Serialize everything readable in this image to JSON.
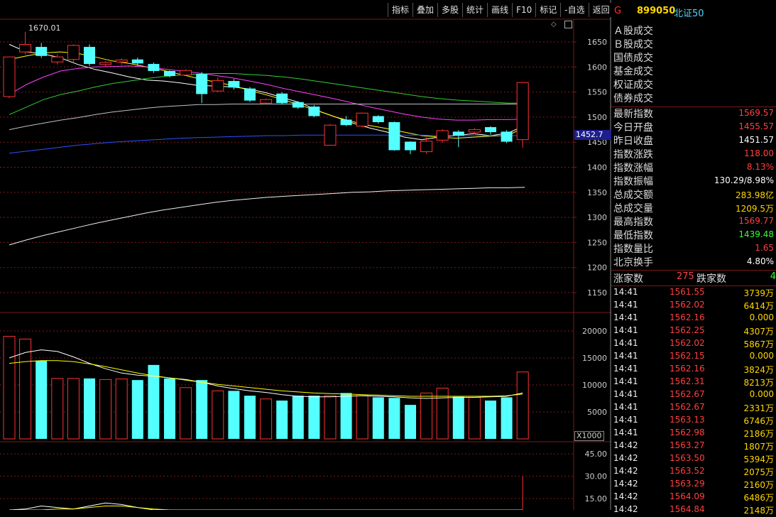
{
  "toolbar": [
    "指标",
    "叠加",
    "多股",
    "统计",
    "画线",
    "F10",
    "标记",
    "-自选",
    "返回"
  ],
  "stock": {
    "flag": "G",
    "code": "899050",
    "name": "北证50"
  },
  "price_tag": "1452.7",
  "peak_label": "1670.01",
  "volume_unit": "X1000",
  "price_axis": [
    "1650",
    "1600",
    "1550",
    "1500",
    "1450",
    "1400",
    "1350",
    "1300",
    "1250",
    "1200",
    "1150"
  ],
  "volume_axis": [
    "20000",
    "15000",
    "10000",
    "5000"
  ],
  "indicator_axis": [
    "45.00",
    "30.00",
    "15.00"
  ],
  "category_labels": [
    "Ａ股成交",
    "Ｂ股成交",
    "国债成交",
    "基金成交",
    "权证成交",
    "债券成交"
  ],
  "stats": [
    {
      "label": "最新指数",
      "value": "1569.57",
      "color": "#ff4040"
    },
    {
      "label": "今日开盘",
      "value": "1455.57",
      "color": "#ff4040"
    },
    {
      "label": "昨日收盘",
      "value": "1451.57",
      "color": "#ffffff"
    },
    {
      "label": "指数涨跌",
      "value": "118.00",
      "color": "#ff4040"
    },
    {
      "label": "指数涨幅",
      "value": "8.13%",
      "color": "#ff4040"
    },
    {
      "label": "指数振幅",
      "value": "130.29/8.98%",
      "color": "#ffffff"
    },
    {
      "label": "总成交额",
      "value": "283.98亿",
      "color": "#ffd700"
    },
    {
      "label": "总成交量",
      "value": "1209.5万",
      "color": "#ffd700"
    },
    {
      "label": "最高指数",
      "value": "1569.77",
      "color": "#ff4040"
    },
    {
      "label": "最低指数",
      "value": "1439.48",
      "color": "#32ff32"
    },
    {
      "label": "指数量比",
      "value": "1.65",
      "color": "#ff4040"
    },
    {
      "label": "北京换手",
      "value": "4.80%",
      "color": "#ffffff"
    }
  ],
  "updown": {
    "up_label": "涨家数",
    "up": "275",
    "down_label": "跌家数",
    "down": "4"
  },
  "ticks": [
    {
      "t": "14:41",
      "p": "1561.55",
      "v": "3739万"
    },
    {
      "t": "14:41",
      "p": "1562.02",
      "v": "6414万"
    },
    {
      "t": "14:41",
      "p": "1562.16",
      "v": "0.000"
    },
    {
      "t": "14:41",
      "p": "1562.25",
      "v": "4307万"
    },
    {
      "t": "14:41",
      "p": "1562.02",
      "v": "5867万"
    },
    {
      "t": "14:41",
      "p": "1562.15",
      "v": "0.000"
    },
    {
      "t": "14:41",
      "p": "1562.16",
      "v": "3824万"
    },
    {
      "t": "14:41",
      "p": "1562.31",
      "v": "8213万"
    },
    {
      "t": "14:41",
      "p": "1562.67",
      "v": "0.000"
    },
    {
      "t": "14:41",
      "p": "1562.67",
      "v": "2331万"
    },
    {
      "t": "14:41",
      "p": "1563.13",
      "v": "6746万"
    },
    {
      "t": "14:41",
      "p": "1562.98",
      "v": "2186万"
    },
    {
      "t": "14:42",
      "p": "1563.27",
      "v": "1807万"
    },
    {
      "t": "14:42",
      "p": "1563.50",
      "v": "5394万"
    },
    {
      "t": "14:42",
      "p": "1563.52",
      "v": "2075万"
    },
    {
      "t": "14:42",
      "p": "1563.29",
      "v": "2160万"
    },
    {
      "t": "14:42",
      "p": "1564.09",
      "v": "6486万"
    },
    {
      "t": "14:42",
      "p": "1564.84",
      "v": "2148万"
    }
  ],
  "colors": {
    "up": "#ff3232",
    "down": "#54ffff",
    "grid": "#7a1a1a"
  },
  "chart_data": {
    "type": "candlestick",
    "candles": [
      {
        "o": 1541,
        "c": 1620,
        "h": 1620,
        "l": 1538
      },
      {
        "o": 1630,
        "c": 1645,
        "h": 1670,
        "l": 1625
      },
      {
        "o": 1640,
        "c": 1622,
        "h": 1648,
        "l": 1618
      },
      {
        "o": 1610,
        "c": 1620,
        "h": 1625,
        "l": 1605
      },
      {
        "o": 1615,
        "c": 1643,
        "h": 1645,
        "l": 1610
      },
      {
        "o": 1640,
        "c": 1606,
        "h": 1645,
        "l": 1602
      },
      {
        "o": 1605,
        "c": 1609,
        "h": 1612,
        "l": 1600
      },
      {
        "o": 1610,
        "c": 1614,
        "h": 1617,
        "l": 1604
      },
      {
        "o": 1615,
        "c": 1607,
        "h": 1619,
        "l": 1602
      },
      {
        "o": 1606,
        "c": 1592,
        "h": 1609,
        "l": 1588
      },
      {
        "o": 1592,
        "c": 1582,
        "h": 1593,
        "l": 1579
      },
      {
        "o": 1584,
        "c": 1593,
        "h": 1595,
        "l": 1582
      },
      {
        "o": 1586,
        "c": 1546,
        "h": 1590,
        "l": 1528
      },
      {
        "o": 1552,
        "c": 1573,
        "h": 1579,
        "l": 1550
      },
      {
        "o": 1572,
        "c": 1559,
        "h": 1576,
        "l": 1555
      },
      {
        "o": 1557,
        "c": 1533,
        "h": 1560,
        "l": 1530
      },
      {
        "o": 1528,
        "c": 1535,
        "h": 1537,
        "l": 1526
      },
      {
        "o": 1547,
        "c": 1528,
        "h": 1550,
        "l": 1525
      },
      {
        "o": 1530,
        "c": 1519,
        "h": 1532,
        "l": 1516
      },
      {
        "o": 1521,
        "c": 1502,
        "h": 1524,
        "l": 1500
      },
      {
        "o": 1444,
        "c": 1484,
        "h": 1486,
        "l": 1443
      },
      {
        "o": 1495,
        "c": 1484,
        "h": 1502,
        "l": 1482
      },
      {
        "o": 1482,
        "c": 1508,
        "h": 1509,
        "l": 1480
      },
      {
        "o": 1502,
        "c": 1490,
        "h": 1504,
        "l": 1487
      },
      {
        "o": 1490,
        "c": 1434,
        "h": 1491,
        "l": 1433
      },
      {
        "o": 1451,
        "c": 1434,
        "h": 1452,
        "l": 1426
      },
      {
        "o": 1431,
        "c": 1452,
        "h": 1460,
        "l": 1427
      },
      {
        "o": 1454,
        "c": 1473,
        "h": 1476,
        "l": 1449
      },
      {
        "o": 1471,
        "c": 1463,
        "h": 1474,
        "l": 1440
      },
      {
        "o": 1470,
        "c": 1475,
        "h": 1478,
        "l": 1466
      },
      {
        "o": 1480,
        "c": 1470,
        "h": 1482,
        "l": 1465
      },
      {
        "o": 1471,
        "c": 1451,
        "h": 1474,
        "l": 1448
      },
      {
        "o": 1455,
        "c": 1569,
        "h": 1570,
        "l": 1439
      }
    ],
    "ma": [
      {
        "color": "#ffffff",
        "values": [
          1645,
          1630,
          1626,
          1618,
          1605,
          1595,
          1588,
          1580,
          1574,
          1572,
          1568,
          1563,
          1562,
          1560,
          1556,
          1548,
          1538,
          1528,
          1512,
          1500,
          1488,
          1478,
          1470,
          1460,
          1455,
          1460,
          1463,
          1467,
          1463,
          1468,
          1483
        ]
      },
      {
        "color": "#ffff00",
        "values": [
          1615,
          1622,
          1628,
          1630,
          1627,
          1620,
          1612,
          1607,
          1600,
          1593,
          1585,
          1577,
          1570,
          1563,
          1553,
          1544,
          1534,
          1523,
          1512,
          1500,
          1491,
          1483,
          1477,
          1470,
          1463,
          1460,
          1458,
          1460,
          1462,
          1463,
          1480
        ]
      },
      {
        "color": "#ff40ff",
        "values": [
          1545,
          1565,
          1580,
          1592,
          1597,
          1600,
          1601,
          1602,
          1600,
          1596,
          1592,
          1588,
          1583,
          1578,
          1572,
          1565,
          1557,
          1550,
          1543,
          1536,
          1528,
          1520,
          1513,
          1506,
          1500,
          1496,
          1494,
          1494,
          1495,
          1495,
          1496
        ]
      },
      {
        "color": "#32cd32",
        "values": [
          1505,
          1520,
          1535,
          1545,
          1552,
          1560,
          1567,
          1572,
          1577,
          1581,
          1584,
          1586,
          1587,
          1587,
          1585,
          1583,
          1580,
          1576,
          1571,
          1566,
          1561,
          1556,
          1551,
          1546,
          1541,
          1537,
          1534,
          1532,
          1530,
          1528,
          1528
        ]
      },
      {
        "color": "#c0c0c0",
        "values": [
          1475,
          1482,
          1488,
          1494,
          1499,
          1505,
          1510,
          1514,
          1518,
          1521,
          1523,
          1525,
          1525,
          1526,
          1526,
          1526,
          1526,
          1526,
          1526,
          1526,
          1526,
          1526,
          1526,
          1526,
          1526,
          1526,
          1526,
          1526,
          1526,
          1526,
          1526
        ]
      },
      {
        "color": "#3050ff",
        "values": [
          1428,
          1432,
          1436,
          1440,
          1444,
          1447,
          1450,
          1452,
          1454,
          1456,
          1458,
          1459,
          1460,
          1461,
          1462,
          1463,
          1463,
          1464,
          1464,
          1464,
          1464,
          1464,
          1464,
          1464,
          1464,
          1463,
          1463,
          1463,
          1463,
          1463,
          1463
        ]
      },
      {
        "color": "#eeeeee",
        "values": [
          1245,
          1255,
          1264,
          1272,
          1280,
          1288,
          1295,
          1302,
          1309,
          1315,
          1320,
          1325,
          1330,
          1334,
          1337,
          1340,
          1342,
          1344,
          1346,
          1348,
          1350,
          1351,
          1353,
          1354,
          1355,
          1356,
          1357,
          1358,
          1359,
          1359,
          1360
        ]
      }
    ],
    "volumes": [
      19000,
      18500,
      14500,
      11200,
      11200,
      11200,
      11000,
      11100,
      10900,
      13700,
      11200,
      9500,
      10900,
      8900,
      8900,
      8000,
      7400,
      7100,
      8000,
      8000,
      8000,
      8500,
      8000,
      7700,
      7600,
      6300,
      8500,
      9400,
      7800,
      7700,
      7100,
      7700,
      12400
    ],
    "vol_ma": [
      {
        "color": "#ffffff",
        "values": [
          15000,
          16000,
          16500,
          16200,
          15200,
          14000,
          13000,
          12200,
          11800,
          11600,
          11300,
          11000,
          10500,
          9800,
          9300,
          8900,
          8600,
          8200,
          7900,
          7800,
          7800,
          7900,
          8000,
          7900,
          7800,
          7600,
          7500,
          7600,
          7700,
          7700,
          7800,
          7900,
          8500
        ]
      },
      {
        "color": "#ffff00",
        "values": [
          14000,
          14300,
          14500,
          14500,
          14300,
          13900,
          13400,
          12800,
          12200,
          11700,
          11300,
          10900,
          10500,
          10100,
          9800,
          9500,
          9200,
          8900,
          8700,
          8500,
          8400,
          8300,
          8200,
          8100,
          8000,
          7900,
          7900,
          7900,
          7900,
          7900,
          7900,
          8000,
          8300
        ]
      }
    ],
    "indicator": [
      {
        "color": "#ffffff",
        "values": [
          6,
          8,
          10,
          9,
          8,
          10,
          12,
          11,
          9,
          7,
          5,
          4,
          3,
          2,
          2,
          2,
          2,
          2,
          2,
          2,
          2,
          2,
          2,
          2,
          2,
          2,
          2,
          2,
          2,
          2,
          2,
          2,
          2
        ]
      },
      {
        "color": "#ffff00",
        "values": [
          5,
          6,
          7,
          8,
          8,
          9,
          10,
          10,
          9,
          8,
          6,
          5,
          4,
          3,
          3,
          2,
          2,
          2,
          2,
          2,
          2,
          2,
          2,
          2,
          2,
          2,
          2,
          2,
          2,
          2,
          2,
          2,
          2
        ]
      }
    ],
    "indicator_spike": 30
  }
}
